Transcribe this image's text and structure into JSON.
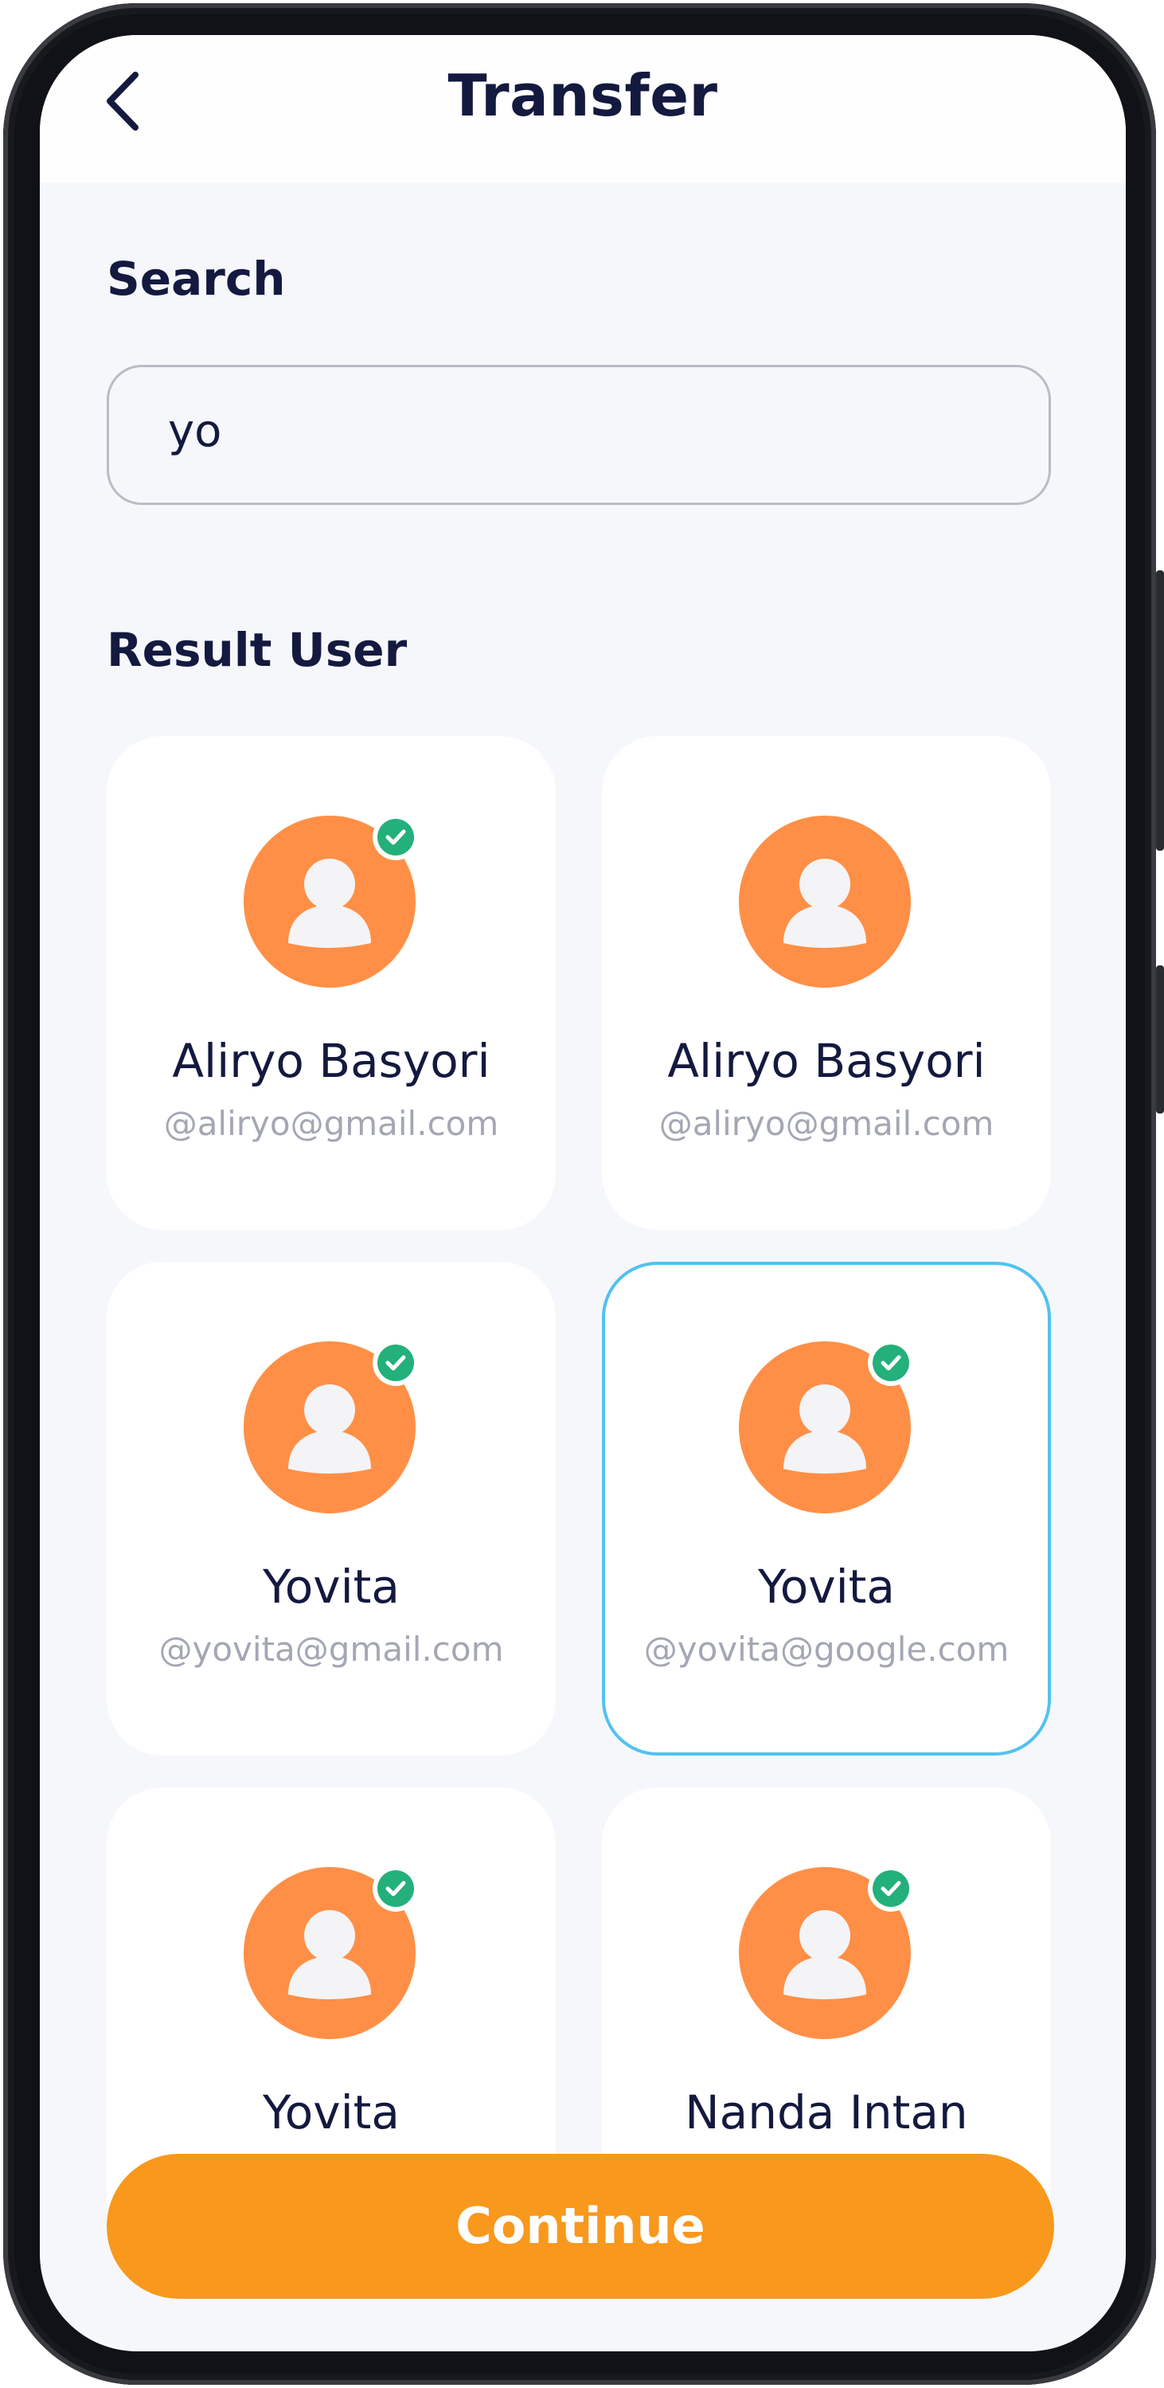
{
  "header": {
    "title": "Transfer",
    "back_icon": "chevron-left-icon"
  },
  "search": {
    "label": "Search",
    "value": "yo"
  },
  "results": {
    "label": "Result User",
    "users": [
      {
        "name": "Aliryo Basyori",
        "email": "@aliryo@gmail.com",
        "verified": true,
        "selected": false
      },
      {
        "name": "Aliryo Basyori",
        "email": "@aliryo@gmail.com",
        "verified": false,
        "selected": false
      },
      {
        "name": "Yovita",
        "email": "@yovita@gmail.com",
        "verified": true,
        "selected": false
      },
      {
        "name": "Yovita",
        "email": "@yovita@google.com",
        "verified": true,
        "selected": true
      },
      {
        "name": "Yovita",
        "email": "",
        "verified": true,
        "selected": false
      },
      {
        "name": "Nanda Intan",
        "email": "",
        "verified": true,
        "selected": false
      }
    ]
  },
  "continue_button": {
    "label": "Continue"
  },
  "colors": {
    "primary_text": "#14193f",
    "accent": "#f8981d",
    "avatar": "#ff8f46",
    "verified": "#23b07a",
    "selected_border": "#53c1f0"
  }
}
